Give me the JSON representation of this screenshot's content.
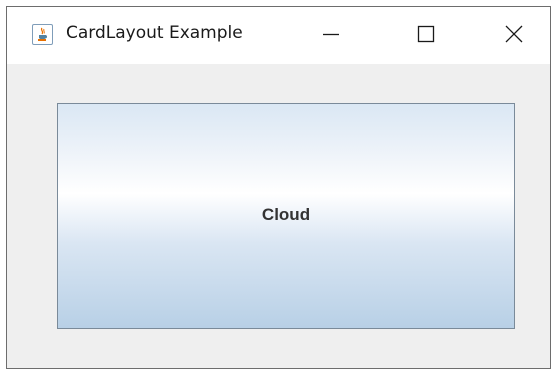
{
  "window": {
    "title": "CardLayout Example",
    "app_icon": "java-coffee-cup-icon",
    "controls": {
      "minimize_icon": "minimize-icon",
      "maximize_icon": "maximize-icon",
      "close_icon": "close-icon"
    }
  },
  "card": {
    "button_label": "Cloud"
  },
  "colors": {
    "frame_background": "#efefef",
    "titlebar_background": "#ffffff",
    "button_border": "#7a8a99",
    "button_gradient_top": "#dae7f4",
    "button_gradient_mid": "#ffffff",
    "button_gradient_bottom": "#b8d0e6",
    "button_text": "#333333"
  }
}
